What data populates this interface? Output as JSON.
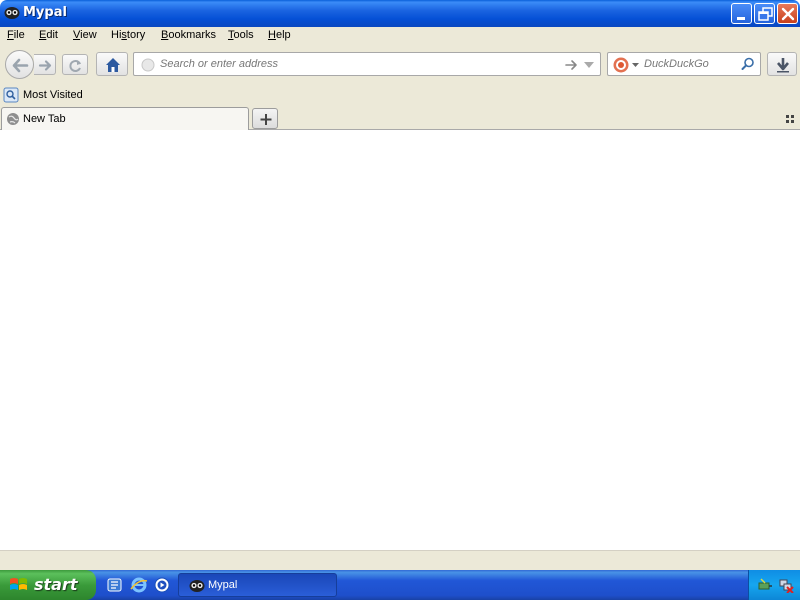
{
  "window": {
    "title": "Mypal"
  },
  "menu": {
    "items": [
      {
        "label": "File",
        "underline": "F"
      },
      {
        "label": "Edit",
        "underline": "E"
      },
      {
        "label": "View",
        "underline": "V"
      },
      {
        "label": "History",
        "underline": "s"
      },
      {
        "label": "Bookmarks",
        "underline": "B"
      },
      {
        "label": "Tools",
        "underline": "T"
      },
      {
        "label": "Help",
        "underline": "H"
      }
    ]
  },
  "navbar": {
    "url_placeholder": "Search or enter address",
    "search_placeholder": "DuckDuckGo"
  },
  "bookmarks": {
    "items": [
      {
        "label": "Most Visited"
      }
    ]
  },
  "tabs": [
    {
      "label": "New Tab"
    }
  ],
  "taskbar": {
    "start_label": "start",
    "tasks": [
      {
        "label": "Mypal"
      }
    ]
  },
  "colors": {
    "titlebar": "#0550d6",
    "chrome": "#ece9d8",
    "taskbar": "#2157d7",
    "start": "#3a9b3a"
  }
}
